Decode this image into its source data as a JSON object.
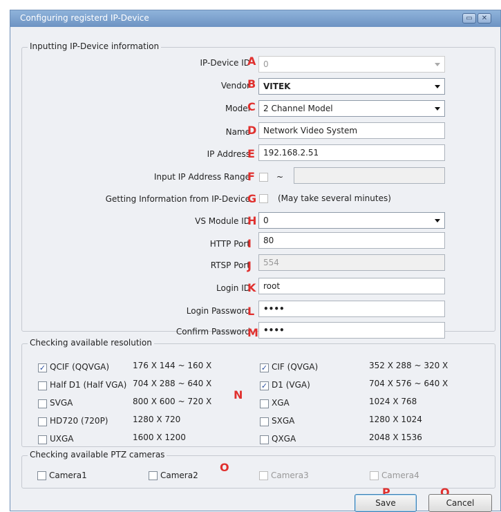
{
  "window": {
    "title": "Configuring registerd IP-Device"
  },
  "info_group": {
    "legend": "Inputting IP-Device information",
    "device_id": {
      "label": "IP-Device ID",
      "marker": "A",
      "value": "0"
    },
    "vendor": {
      "label": "Vendor",
      "marker": "B",
      "value": "VITEK"
    },
    "model": {
      "label": "Model",
      "marker": "C",
      "value": "2 Channel Model"
    },
    "name": {
      "label": "Name",
      "marker": "D",
      "value": "Network Video System"
    },
    "ip_address": {
      "label": "IP Address",
      "marker": "E",
      "value": "192.168.2.51"
    },
    "ip_range": {
      "label": "Input IP Address Range",
      "marker": "F",
      "separator": "~",
      "value": ""
    },
    "get_info": {
      "label": "Getting Information from IP-Device",
      "marker": "G",
      "note": "(May take several minutes)"
    },
    "vs_module_id": {
      "label": "VS Module ID",
      "marker": "H",
      "value": "0"
    },
    "http_port": {
      "label": "HTTP Port",
      "marker": "I",
      "value": "80"
    },
    "rtsp_port": {
      "label": "RTSP Port",
      "marker": "J",
      "value": "554"
    },
    "login_id": {
      "label": "Login ID",
      "marker": "K",
      "value": "root"
    },
    "login_password": {
      "label": "Login Password",
      "marker": "L",
      "value": "••••"
    },
    "confirm_password": {
      "label": "Confirm Password",
      "marker": "M",
      "value": "••••"
    }
  },
  "resolution_group": {
    "legend": "Checking available resolution",
    "marker": "N",
    "left": [
      {
        "name": "QCIF (QQVGA)",
        "res": "176 X 144 ~ 160 X",
        "checked": true
      },
      {
        "name": "Half D1 (Half VGA)",
        "res": "704 X 288 ~ 640 X",
        "checked": false
      },
      {
        "name": "SVGA",
        "res": "800 X 600 ~ 720 X",
        "checked": false
      },
      {
        "name": "HD720 (720P)",
        "res": "1280 X 720",
        "checked": false
      },
      {
        "name": "UXGA",
        "res": "1600 X 1200",
        "checked": false
      }
    ],
    "right": [
      {
        "name": "CIF (QVGA)",
        "res": "352 X 288 ~ 320 X",
        "checked": true
      },
      {
        "name": "D1 (VGA)",
        "res": "704 X 576 ~ 640 X",
        "checked": true
      },
      {
        "name": "XGA",
        "res": "1024 X 768",
        "checked": false
      },
      {
        "name": "SXGA",
        "res": "1280 X 1024",
        "checked": false
      },
      {
        "name": "QXGA",
        "res": "2048 X 1536",
        "checked": false
      }
    ]
  },
  "ptz_group": {
    "legend": "Checking available PTZ cameras",
    "marker": "O",
    "cameras": [
      {
        "label": "Camera1",
        "enabled": true
      },
      {
        "label": "Camera2",
        "enabled": true
      },
      {
        "label": "Camera3",
        "enabled": false
      },
      {
        "label": "Camera4",
        "enabled": false
      }
    ]
  },
  "buttons": {
    "save": {
      "label": "Save",
      "marker": "P"
    },
    "cancel": {
      "label": "Cancel",
      "marker": "O"
    }
  },
  "colors": {
    "marker": "#e0302e",
    "titlebar": "#7fa4d0",
    "checkmark": "#2a4fa0"
  }
}
